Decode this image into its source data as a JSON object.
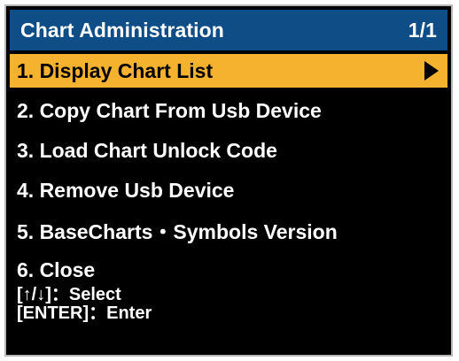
{
  "window": {
    "title": "Chart Administration",
    "page_indicator": "1/1"
  },
  "menu": {
    "items": [
      {
        "label": "1. Display Chart List",
        "selected": true
      },
      {
        "label": "2. Copy Chart From Usb Device",
        "selected": false
      },
      {
        "label": "3. Load Chart Unlock Code",
        "selected": false
      },
      {
        "label": "4. Remove Usb Device",
        "selected": false
      },
      {
        "label": "5. BaseCharts・Symbols Version",
        "selected": false
      },
      {
        "label": "6. Close",
        "selected": false
      }
    ],
    "submenu_icon": "right-triangle-icon"
  },
  "help": {
    "line1": "[↑/↓]：Select",
    "line2": "[ENTER]：Enter"
  },
  "colors": {
    "background": "#000000",
    "title_bar": "#0f4d87",
    "selection": "#f4b22e",
    "text": "#ffffff"
  }
}
